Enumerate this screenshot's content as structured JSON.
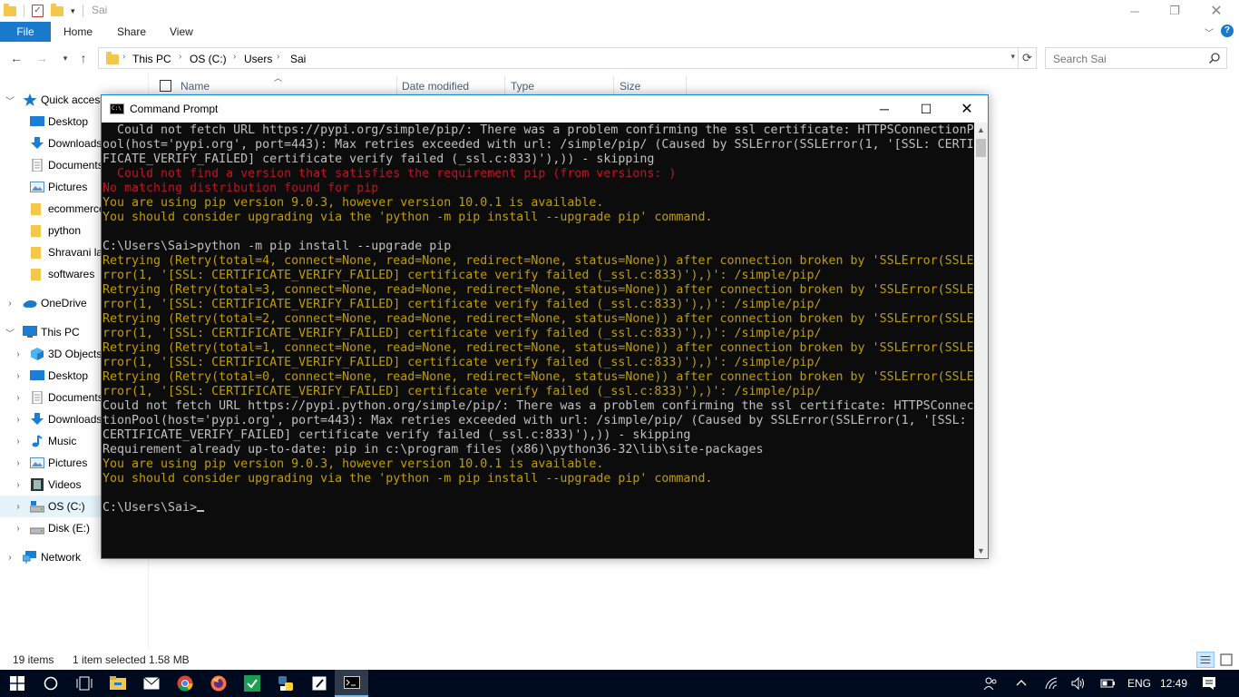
{
  "explorer": {
    "title": "Sai",
    "ribbon_tabs": [
      "File",
      "Home",
      "Share",
      "View"
    ],
    "breadcrumb": [
      "This PC",
      "OS (C:)",
      "Users",
      "Sai"
    ],
    "search_placeholder": "Search Sai",
    "columns": [
      "Name",
      "Date modified",
      "Type",
      "Size"
    ],
    "status": {
      "item_count": "19 items",
      "selection": "1 item selected",
      "selected_size": "1.58 MB"
    }
  },
  "nav_pane": {
    "items": [
      {
        "label": "Quick access",
        "icon": "star-icon"
      },
      {
        "label": "Desktop",
        "icon": "desktop-icon"
      },
      {
        "label": "Downloads",
        "icon": "downloads-icon"
      },
      {
        "label": "Documents",
        "icon": "documents-icon"
      },
      {
        "label": "Pictures",
        "icon": "pictures-icon"
      },
      {
        "label": "ecommerce",
        "icon": "folder-icon"
      },
      {
        "label": "python",
        "icon": "folder-icon"
      },
      {
        "label": "Shravani la",
        "icon": "folder-icon"
      },
      {
        "label": "softwares",
        "icon": "folder-icon"
      },
      {
        "label": "OneDrive",
        "icon": "onedrive-icon"
      },
      {
        "label": "This PC",
        "icon": "computer-icon"
      },
      {
        "label": "3D Objects",
        "icon": "3d-objects-icon"
      },
      {
        "label": "Desktop",
        "icon": "desktop-icon"
      },
      {
        "label": "Documents",
        "icon": "documents-icon"
      },
      {
        "label": "Downloads",
        "icon": "downloads-icon"
      },
      {
        "label": "Music",
        "icon": "music-icon"
      },
      {
        "label": "Pictures",
        "icon": "pictures-icon"
      },
      {
        "label": "Videos",
        "icon": "videos-icon"
      },
      {
        "label": "OS (C:)",
        "icon": "drive-c-icon"
      },
      {
        "label": "Disk (E:)",
        "icon": "drive-icon"
      },
      {
        "label": "Network",
        "icon": "network-icon"
      }
    ]
  },
  "cmd": {
    "title": "Command Prompt",
    "lines": [
      {
        "text": "  Could not fetch URL https://pypi.org/simple/pip/: There was a problem confirming the ssl certificate: HTTPSConnectionP",
        "color": "gray"
      },
      {
        "text": "ool(host='pypi.org', port=443): Max retries exceeded with url: /simple/pip/ (Caused by SSLError(SSLError(1, '[SSL: CERTI",
        "color": "gray"
      },
      {
        "text": "FICATE_VERIFY_FAILED] certificate verify failed (_ssl.c:833)'),)) - skipping",
        "color": "gray"
      },
      {
        "text": "  Could not find a version that satisfies the requirement pip (from versions: )",
        "color": "red"
      },
      {
        "text": "No matching distribution found for pip",
        "color": "red"
      },
      {
        "text": "You are using pip version 9.0.3, however version 10.0.1 is available.",
        "color": "yellow"
      },
      {
        "text": "You should consider upgrading via the 'python -m pip install --upgrade pip' command.",
        "color": "yellow"
      },
      {
        "text": "",
        "color": "gray"
      },
      {
        "text": "C:\\Users\\Sai>python -m pip install --upgrade pip",
        "color": "gray"
      },
      {
        "text": "Retrying (Retry(total=4, connect=None, read=None, redirect=None, status=None)) after connection broken by 'SSLError(SSLE",
        "color": "yellow"
      },
      {
        "text": "rror(1, '[SSL: CERTIFICATE_VERIFY_FAILED] certificate verify failed (_ssl.c:833)'),)': /simple/pip/",
        "color": "yellow"
      },
      {
        "text": "Retrying (Retry(total=3, connect=None, read=None, redirect=None, status=None)) after connection broken by 'SSLError(SSLE",
        "color": "yellow"
      },
      {
        "text": "rror(1, '[SSL: CERTIFICATE_VERIFY_FAILED] certificate verify failed (_ssl.c:833)'),)': /simple/pip/",
        "color": "yellow"
      },
      {
        "text": "Retrying (Retry(total=2, connect=None, read=None, redirect=None, status=None)) after connection broken by 'SSLError(SSLE",
        "color": "yellow"
      },
      {
        "text": "rror(1, '[SSL: CERTIFICATE_VERIFY_FAILED] certificate verify failed (_ssl.c:833)'),)': /simple/pip/",
        "color": "yellow"
      },
      {
        "text": "Retrying (Retry(total=1, connect=None, read=None, redirect=None, status=None)) after connection broken by 'SSLError(SSLE",
        "color": "yellow"
      },
      {
        "text": "rror(1, '[SSL: CERTIFICATE_VERIFY_FAILED] certificate verify failed (_ssl.c:833)'),)': /simple/pip/",
        "color": "yellow"
      },
      {
        "text": "Retrying (Retry(total=0, connect=None, read=None, redirect=None, status=None)) after connection broken by 'SSLError(SSLE",
        "color": "yellow"
      },
      {
        "text": "rror(1, '[SSL: CERTIFICATE_VERIFY_FAILED] certificate verify failed (_ssl.c:833)'),)': /simple/pip/",
        "color": "yellow"
      },
      {
        "text": "Could not fetch URL https://pypi.python.org/simple/pip/: There was a problem confirming the ssl certificate: HTTPSConnec",
        "color": "gray"
      },
      {
        "text": "tionPool(host='pypi.org', port=443): Max retries exceeded with url: /simple/pip/ (Caused by SSLError(SSLError(1, '[SSL:",
        "color": "gray"
      },
      {
        "text": "CERTIFICATE_VERIFY_FAILED] certificate verify failed (_ssl.c:833)'),)) - skipping",
        "color": "gray"
      },
      {
        "text": "Requirement already up-to-date: pip in c:\\program files (x86)\\python36-32\\lib\\site-packages",
        "color": "gray"
      },
      {
        "text": "You are using pip version 9.0.3, however version 10.0.1 is available.",
        "color": "yellow"
      },
      {
        "text": "You should consider upgrading via the 'python -m pip install --upgrade pip' command.",
        "color": "yellow"
      },
      {
        "text": "",
        "color": "gray"
      },
      {
        "text": "C:\\Users\\Sai>",
        "color": "gray",
        "cursor": true
      }
    ]
  },
  "taskbar": {
    "apps": [
      "start-icon",
      "cortana-icon",
      "task-view-icon",
      "file-explorer-icon",
      "mail-icon",
      "chrome-icon",
      "firefox-icon",
      "app-green-icon",
      "python-icon",
      "notes-icon",
      "cmd-icon"
    ],
    "language": "ENG",
    "time": "12:49"
  },
  "colors": {
    "accent": "#1979ca",
    "console_bg": "#0c0c0c",
    "console_gray": "#c0c0c0",
    "console_red": "#c50f1f",
    "console_yellow": "#c19c00",
    "taskbar_bg": "#000a1e"
  }
}
